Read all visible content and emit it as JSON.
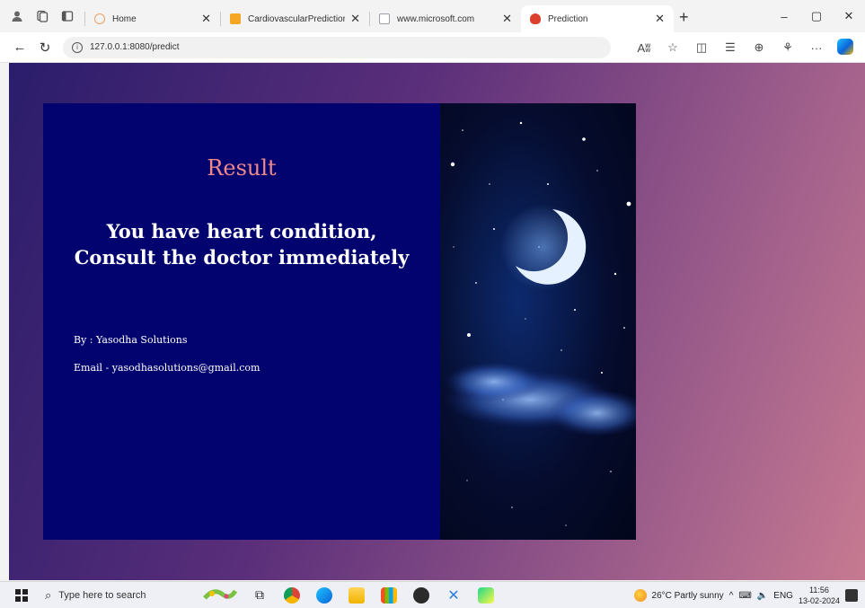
{
  "browser": {
    "tabs": [
      {
        "label": "Home",
        "favicon_color": "#f0a060",
        "active": false
      },
      {
        "label": "CardiovascularPrediction",
        "favicon_color": "#f5a623",
        "active": false
      },
      {
        "label": "www.microsoft.com",
        "favicon_color": "#9aa0a6",
        "active": false
      },
      {
        "label": "Prediction",
        "favicon_color": "#d9412c",
        "active": true
      }
    ],
    "url": "127.0.0.1:8080/predict",
    "icons": {
      "profile": "person-icon",
      "workspaces": "workspaces-icon",
      "tab_actions": "tab-actions-icon",
      "new_tab": "+",
      "minimize": "–",
      "maximize": "▢",
      "close": "✕",
      "back": "←",
      "refresh": "↻",
      "read_aloud": "Aʬ",
      "favorite": "☆",
      "split": "◫",
      "favorites": "☰",
      "collections": "⊕",
      "extensions": "⚘",
      "more": "···"
    }
  },
  "page": {
    "title": "Result",
    "message": "You have heart condition, Consult the doctor immediately",
    "byline": "By : Yasodha Solutions",
    "email": "Email - yasodhasolutions@gmail.com",
    "colors": {
      "background_start": "#2a1d6b",
      "background_end": "#c77a91",
      "card_left": "#02036e",
      "title": "#f08a8a"
    }
  },
  "taskbar": {
    "search_placeholder": "Type here to search",
    "weather": "26°C  Partly sunny",
    "language": "ENG",
    "time": "11:56",
    "date": "13-02-2024"
  }
}
